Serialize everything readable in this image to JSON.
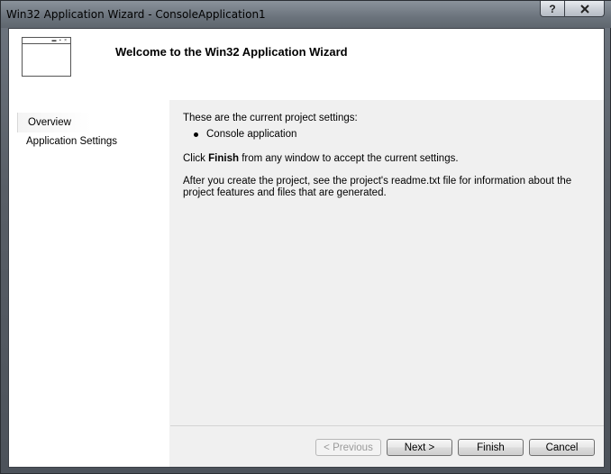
{
  "window": {
    "title": "Win32 Application Wizard - ConsoleApplication1",
    "help_button": "?",
    "close_icon": "close-icon"
  },
  "header": {
    "title": "Welcome to the Win32 Application Wizard",
    "icon": "window-icon"
  },
  "sidebar": {
    "items": [
      {
        "label": "Overview",
        "selected": true
      },
      {
        "label": "Application Settings",
        "selected": false
      }
    ]
  },
  "content": {
    "settings_intro": "These are the current project settings:",
    "settings": [
      "Console application"
    ],
    "finish_prefix": "Click ",
    "finish_bold": "Finish",
    "finish_suffix": " from any window to accept the current settings.",
    "readme_line1": "After you create the project, see the project's readme.txt file for information about the",
    "readme_line2": "project features and files that are generated."
  },
  "buttons": {
    "previous": "< Previous",
    "next": "Next >",
    "finish": "Finish",
    "cancel": "Cancel"
  }
}
